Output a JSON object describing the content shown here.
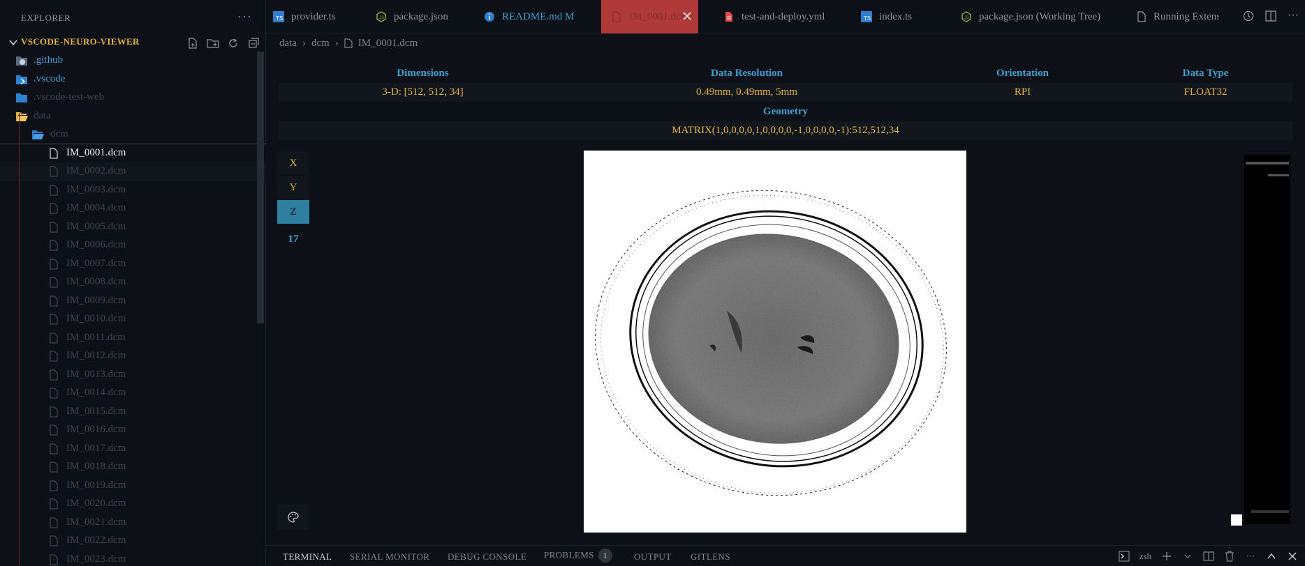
{
  "sidebar": {
    "header": "EXPLORER",
    "root": "VSCODE-NEURO-VIEWER",
    "folders": [
      {
        "label": ".github",
        "color": "#3f9fd1"
      },
      {
        "label": ".vscode",
        "color": "#3f9fd1"
      },
      {
        "label": ".vscode-test-web",
        "color": "#3a4552"
      },
      {
        "label": "data",
        "color": "#3a4552"
      },
      {
        "label": "dcm",
        "color": "#3a4552"
      }
    ],
    "files": [
      "IM_0001.dcm",
      "IM_0002.dcm",
      "IM_0003.dcm",
      "IM_0004.dcm",
      "IM_0005.dcm",
      "IM_0006.dcm",
      "IM_0007.dcm",
      "IM_0008.dcm",
      "IM_0009.dcm",
      "IM_0010.dcm",
      "IM_0011.dcm",
      "IM_0012.dcm",
      "IM_0013.dcm",
      "IM_0014.dcm",
      "IM_0015.dcm",
      "IM_0016.dcm",
      "IM_0017.dcm",
      "IM_0018.dcm",
      "IM_0019.dcm",
      "IM_0020.dcm",
      "IM_0021.dcm",
      "IM_0022.dcm",
      "IM_0023.dcm"
    ]
  },
  "tabs": [
    {
      "label": "provider.ts",
      "icon": "typescript-icon",
      "color": "#8b949e"
    },
    {
      "label": "package.json",
      "icon": "nodejs-icon",
      "color": "#8b949e"
    },
    {
      "label": "README.md  M",
      "icon": "info-icon",
      "color": "#3f9fd1"
    },
    {
      "label": "IM_0001.dcm",
      "icon": "file-icon",
      "color": "#8a2c2c"
    },
    {
      "label": "test-and-deploy.yml",
      "icon": "yaml-icon",
      "color": "#8b949e"
    },
    {
      "label": "index.ts",
      "icon": "typescript-icon",
      "color": "#8b949e"
    },
    {
      "label": "package.json (Working Tree)",
      "icon": "nodejs-icon",
      "color": "#8b949e"
    },
    {
      "label": "Running Extensions",
      "icon": "file-icon",
      "color": "#8b949e"
    }
  ],
  "breadcrumb": [
    "data",
    "dcm",
    "IM_0001.dcm"
  ],
  "info": {
    "headers": [
      "Dimensions",
      "Data Resolution",
      "Orientation",
      "Data Type"
    ],
    "values": [
      "3-D: [512, 512, 34]",
      "0.49mm, 0.49mm, 5mm",
      "RPI",
      "FLOAT32"
    ],
    "geometry_header": "Geometry",
    "geometry_value": "MATRIX(1,0,0,0,0,1,0,0,0,0,-1,0,0,0,0,-1):512,512,34"
  },
  "viewer": {
    "axes": [
      "X",
      "Y",
      "Z"
    ],
    "active_axis": "Z",
    "slice": "17"
  },
  "panel": {
    "tabs": [
      "TERMINAL",
      "SERIAL MONITOR",
      "DEBUG CONSOLE",
      "PROBLEMS",
      "OUTPUT",
      "GITLENS"
    ],
    "problems_count": "1",
    "shell": "zsh"
  },
  "colors": {
    "accent": "#3f9fd1",
    "value": "#e3b341",
    "active_tab": "#b03a3a",
    "active_axis": "#2e7fa0"
  }
}
